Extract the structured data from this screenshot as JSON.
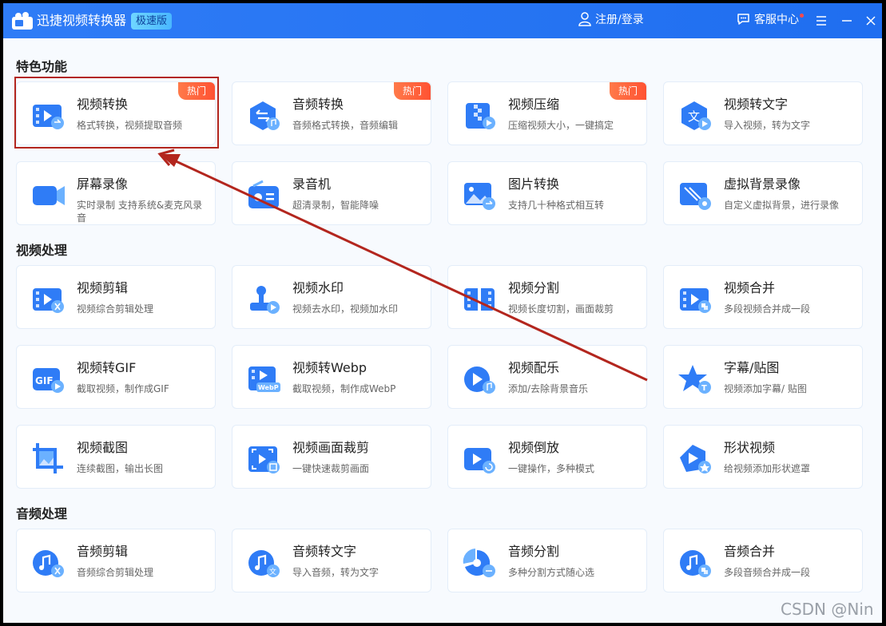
{
  "app": {
    "title": "迅捷视频转换器",
    "edition": "极速版",
    "login": "注册/登录",
    "support": "客服中心"
  },
  "sections": {
    "featured": "特色功能",
    "video": "视频处理",
    "audio": "音频处理"
  },
  "cards": {
    "video_convert": {
      "name": "视频转换",
      "desc": "格式转换，视频提取音频",
      "hot": "热门"
    },
    "audio_convert": {
      "name": "音频转换",
      "desc": "音频格式转换，音频编辑",
      "hot": "热门"
    },
    "video_compress": {
      "name": "视频压缩",
      "desc": "压缩视频大小，一键搞定",
      "hot": "热门"
    },
    "video_to_text": {
      "name": "视频转文字",
      "desc": "导入视频，转为文字"
    },
    "screen_record": {
      "name": "屏幕录像",
      "desc": "实时录制 支持系统&麦克风录音"
    },
    "recorder": {
      "name": "录音机",
      "desc": "超清录制，智能降噪"
    },
    "image_convert": {
      "name": "图片转换",
      "desc": "支持几十种格式相互转"
    },
    "virtual_bg": {
      "name": "虚拟背景录像",
      "desc": "自定义虚拟背景，进行录像"
    },
    "video_edit": {
      "name": "视频剪辑",
      "desc": "视频综合剪辑处理"
    },
    "video_watermark": {
      "name": "视频水印",
      "desc": "视频去水印，视频加水印"
    },
    "video_split": {
      "name": "视频分割",
      "desc": "视频长度切割，画面裁剪"
    },
    "video_merge": {
      "name": "视频合并",
      "desc": "多段视频合并成一段"
    },
    "video_to_gif": {
      "name": "视频转GIF",
      "desc": "截取视频，制作成GIF"
    },
    "video_to_webp": {
      "name": "视频转Webp",
      "desc": "截取视频，制作成WebP"
    },
    "video_music": {
      "name": "视频配乐",
      "desc": "添加/去除背景音乐"
    },
    "subtitle": {
      "name": "字幕/贴图",
      "desc": "视频添加字幕/ 贴图"
    },
    "video_screenshot": {
      "name": "视频截图",
      "desc": "连续截图，输出长图"
    },
    "video_crop": {
      "name": "视频画面裁剪",
      "desc": "一键快速裁剪画面"
    },
    "video_reverse": {
      "name": "视频倒放",
      "desc": "一键操作，多种模式"
    },
    "shape_video": {
      "name": "形状视频",
      "desc": "给视频添加形状遮罩"
    },
    "audio_edit": {
      "name": "音频剪辑",
      "desc": "音频综合剪辑处理"
    },
    "audio_to_text": {
      "name": "音频转文字",
      "desc": "导入音频，转为文字"
    },
    "audio_split": {
      "name": "音频分割",
      "desc": "多种分割方式随心选"
    },
    "audio_merge": {
      "name": "音频合并",
      "desc": "多段音频合并成一段"
    }
  },
  "watermark": "CSDN @Nin",
  "colors": {
    "accent": "#2f7cf6",
    "hot": "#ff5a3a",
    "highlight": "#b3261e"
  }
}
